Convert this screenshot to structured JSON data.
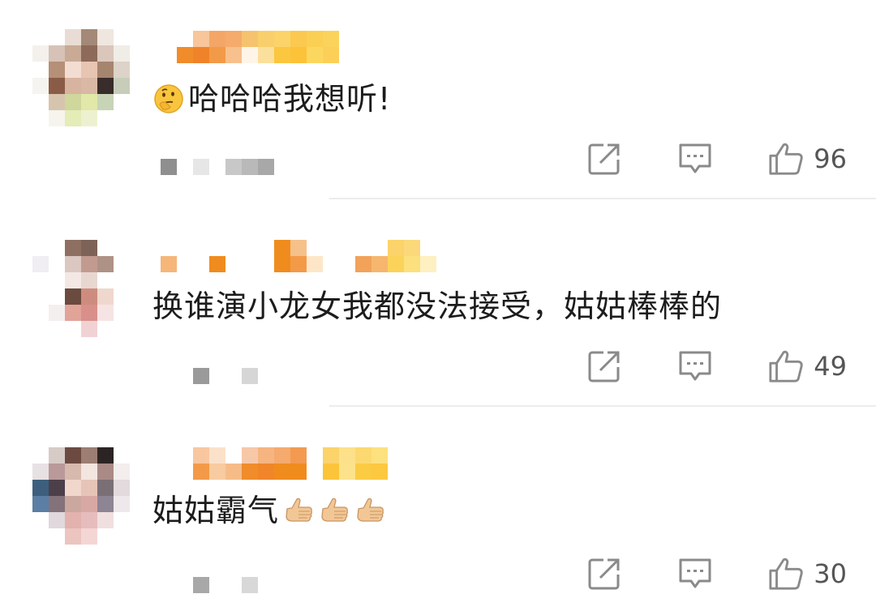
{
  "comments": [
    {
      "text": "哈哈哈我想听!",
      "has_leading_emoji": true,
      "trailing_emoji_count": 0,
      "meta_text": "",
      "likes": "96"
    },
    {
      "text": "换谁演小龙女我都没法接受，姑姑棒棒的",
      "has_leading_emoji": false,
      "trailing_emoji_count": 0,
      "meta_text": "",
      "likes": "49"
    },
    {
      "text": "姑姑霸气",
      "has_leading_emoji": false,
      "trailing_emoji_count": 3,
      "meta_text": "",
      "likes": "30"
    }
  ],
  "icons": {
    "share": "share-icon",
    "reply": "comment-icon",
    "like": "thumb-up-icon",
    "leading_emoji": "thinking-face-emoji",
    "trailing_emoji": "thumbs-up-emoji"
  },
  "colors": {
    "username_orange": "#f08c1e",
    "username_yellow": "#ffd24a",
    "icon_gray": "#888888",
    "text": "#1c1c1c",
    "like_count": "#555555"
  }
}
